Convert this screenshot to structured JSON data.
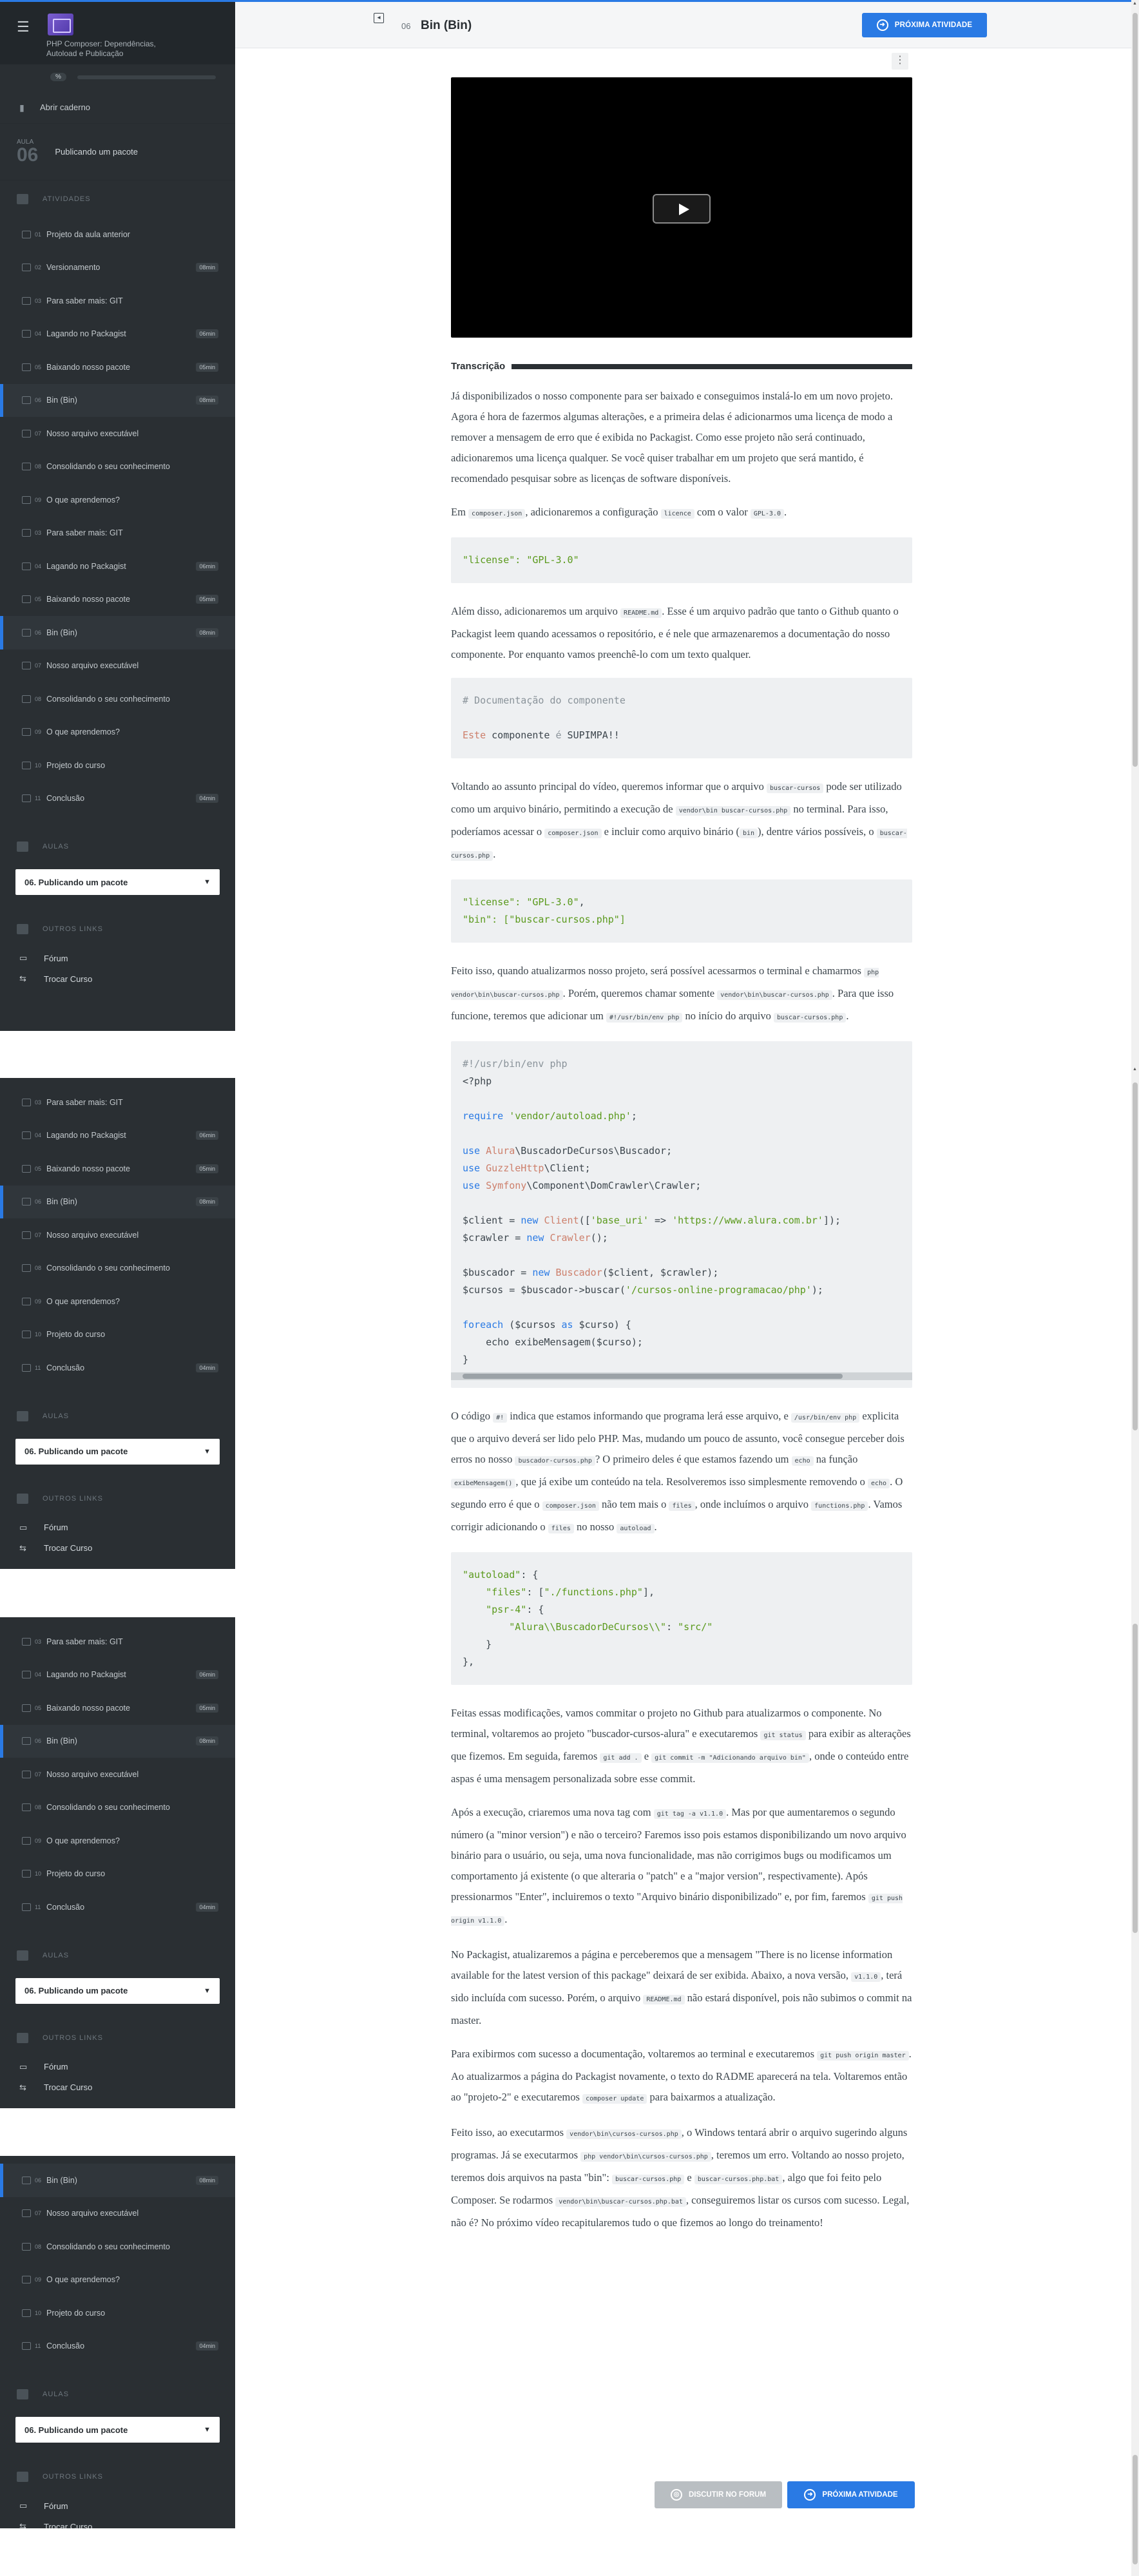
{
  "header": {
    "lesson_number": "06",
    "lesson_title": "Bin (Bin)",
    "next_button": "PRÓXIMA ATIVIDADE"
  },
  "sidebar": {
    "course_title": "PHP Composer: Dependências, Autoload e Publicação",
    "progress_label": "%",
    "progress_fraction": 0.0,
    "open_notebook": "Abrir caderno",
    "section_label": "AULA",
    "section_number": "06",
    "section_title": "Publicando um pacote",
    "activities_label": "ATIVIDADES",
    "classes_label": "AULAS",
    "classes_selected": "06. Publicando um pacote",
    "other_links_label": "OUTROS LINKS",
    "links": [
      "Fórum",
      "Trocar Curso"
    ],
    "activities_first": [
      {
        "num": "01",
        "title": "Projeto da aula anterior",
        "dur": ""
      },
      {
        "num": "02",
        "title": "Versionamento",
        "dur": "08min"
      },
      {
        "num": "03",
        "title": "Para saber mais: GIT",
        "dur": ""
      },
      {
        "num": "04",
        "title": "Lagando no Packagist",
        "dur": "06min"
      },
      {
        "num": "05",
        "title": "Baixando nosso pacote",
        "dur": "05min"
      },
      {
        "num": "06",
        "title": "Bin (Bin)",
        "dur": "08min",
        "active": true
      },
      {
        "num": "07",
        "title": "Nosso arquivo executável",
        "dur": ""
      },
      {
        "num": "08",
        "title": "Consolidando o seu conhecimento",
        "dur": ""
      },
      {
        "num": "09",
        "title": "O que aprendemos?",
        "dur": ""
      },
      {
        "num": "03",
        "title": "Para saber mais: GIT",
        "dur": ""
      },
      {
        "num": "04",
        "title": "Lagando no Packagist",
        "dur": "06min"
      },
      {
        "num": "05",
        "title": "Baixando nosso pacote",
        "dur": "05min"
      },
      {
        "num": "06",
        "title": "Bin (Bin)",
        "dur": "08min",
        "active": true
      },
      {
        "num": "07",
        "title": "Nosso arquivo executável",
        "dur": ""
      },
      {
        "num": "08",
        "title": "Consolidando o seu conhecimento",
        "dur": ""
      },
      {
        "num": "09",
        "title": "O que aprendemos?",
        "dur": ""
      },
      {
        "num": "10",
        "title": "Projeto do curso",
        "dur": ""
      },
      {
        "num": "11",
        "title": "Conclusão",
        "dur": "04min"
      }
    ],
    "activities_repeat": [
      {
        "num": "03",
        "title": "Para saber mais: GIT",
        "dur": ""
      },
      {
        "num": "04",
        "title": "Lagando no Packagist",
        "dur": "06min"
      },
      {
        "num": "05",
        "title": "Baixando nosso pacote",
        "dur": "05min"
      },
      {
        "num": "06",
        "title": "Bin (Bin)",
        "dur": "08min",
        "active": true
      },
      {
        "num": "07",
        "title": "Nosso arquivo executável",
        "dur": ""
      },
      {
        "num": "08",
        "title": "Consolidando o seu conhecimento",
        "dur": ""
      },
      {
        "num": "09",
        "title": "O que aprendemos?",
        "dur": ""
      },
      {
        "num": "10",
        "title": "Projeto do curso",
        "dur": ""
      },
      {
        "num": "11",
        "title": "Conclusão",
        "dur": "04min"
      }
    ],
    "activities_last": [
      {
        "num": "06",
        "title": "Bin (Bin)",
        "dur": "08min",
        "active": true
      },
      {
        "num": "07",
        "title": "Nosso arquivo executável",
        "dur": ""
      },
      {
        "num": "08",
        "title": "Consolidando o seu conhecimento",
        "dur": ""
      },
      {
        "num": "09",
        "title": "O que aprendemos?",
        "dur": ""
      },
      {
        "num": "10",
        "title": "Projeto do curso",
        "dur": ""
      },
      {
        "num": "11",
        "title": "Conclusão",
        "dur": "04min"
      }
    ]
  },
  "main": {
    "transcription_title": "Transcrição",
    "discuss_button": "DISCUTIR NO FORUM",
    "next_button": "PRÓXIMA ATIVIDADE",
    "paragraphs": [
      [
        "Já disponibilizados o nosso componente para ser baixado e conseguimos instalá-lo em um novo projeto. Agora é hora de fazermos algumas alterações, e a primeira delas é adicionarmos uma licença de modo a remover a mensagem de erro que é exibida no Packagist. Como esse projeto não será continuado, adicionaremos uma licença qualquer. Se você quiser trabalhar em um projeto que será mantido, é recomendado pesquisar sobre as licenças de software disponíveis."
      ],
      [
        "Em ",
        {
          "c": "composer.json"
        },
        ", adicionaremos a configuração ",
        {
          "c": "licence"
        },
        " com o valor ",
        {
          "c": "GPL-3.0"
        },
        "."
      ],
      [
        "Além disso, adicionaremos um arquivo ",
        {
          "c": "README.md"
        },
        ". Esse é um arquivo padrão que tanto o Github quanto o Packagist leem quando acessamos o repositório, e é nele que armazenaremos a documentação do nosso componente. Por enquanto vamos preenchê-lo com um texto qualquer."
      ],
      [
        "Voltando ao assunto principal do vídeo, queremos informar que o arquivo ",
        {
          "c": "buscar-cursos"
        },
        " pode ser utilizado como um arquivo binário, permitindo a execução de ",
        {
          "c": "vendor\\bin buscar-cursos.php"
        },
        " no terminal. Para isso, poderíamos acessar o ",
        {
          "c": "composer.json"
        },
        " e incluir como arquivo binário (",
        {
          "c": "bin"
        },
        "), dentre vários possíveis, o ",
        {
          "c": "buscar-cursos.php"
        },
        "."
      ],
      [
        "Feito isso, quando atualizarmos nosso projeto, será possível acessarmos o terminal e chamarmos ",
        {
          "c": "php vendor\\bin\\buscar-cursos.php"
        },
        ". Porém, queremos chamar somente ",
        {
          "c": "vendor\\bin\\buscar-cursos.php"
        },
        ". Para que isso funcione, teremos que adicionar um ",
        {
          "c": "#!/usr/bin/env php"
        },
        " no início do arquivo ",
        {
          "c": "buscar-cursos.php"
        },
        "."
      ],
      [
        "O código ",
        {
          "c": "#!"
        },
        " indica que estamos informando que programa lerá esse arquivo, e ",
        {
          "c": "/usr/bin/env php"
        },
        " explicita que o arquivo deverá ser lido pelo PHP. Mas, mudando um pouco de assunto, você consegue perceber dois erros no nosso ",
        {
          "c": "buscador-cursos.php"
        },
        "? O primeiro deles é que estamos fazendo um ",
        {
          "c": "echo"
        },
        " na função ",
        {
          "c": "exibeMensagem()"
        },
        ", que já exibe um conteúdo na tela. Resolveremos isso simplesmente removendo o ",
        {
          "c": "echo"
        },
        ". O segundo erro é que o ",
        {
          "c": "composer.json"
        },
        " não tem mais o ",
        {
          "c": "files"
        },
        ", onde incluímos o arquivo ",
        {
          "c": "functions.php"
        },
        ". Vamos corrigir adicionando o ",
        {
          "c": "files"
        },
        " no nosso ",
        {
          "c": "autoload"
        },
        "."
      ],
      [
        "Feitas essas modificações, vamos commitar o projeto no Github para atualizarmos o componente. No terminal, voltaremos ao projeto \"buscador-cursos-alura\" e executaremos ",
        {
          "c": "git status"
        },
        " para exibir as alterações que fizemos. Em seguida, faremos ",
        {
          "c": "git add ."
        },
        " e ",
        {
          "c": "git commit -m \"Adicionando arquivo bin\""
        },
        ", onde o conteúdo entre aspas é uma mensagem personalizada sobre esse commit."
      ],
      [
        "Após a execução, criaremos uma nova tag com ",
        {
          "c": "git tag -a v1.1.0"
        },
        ". Mas por que aumentaremos o segundo número (a \"minor version\") e não o terceiro? Faremos isso pois estamos disponibilizando um novo arquivo binário para o usuário, ou seja, uma nova funcionalidade, mas não corrigimos bugs ou modificamos um comportamento já existente (o que alteraria o \"patch\" e a \"major version\", respectivamente). Após pressionarmos \"Enter\", incluiremos o texto \"Arquivo binário disponibilizado\" e, por fim, faremos ",
        {
          "c": "git push origin v1.1.0"
        },
        "."
      ],
      [
        "No Packagist, atualizaremos a página e perceberemos que a mensagem \"There is no license information available for the latest version of this package\" deixará de ser exibida. Abaixo, a nova versão, ",
        {
          "c": "v1.1.0"
        },
        ", terá sido incluída com sucesso. Porém, o arquivo ",
        {
          "c": "README.md"
        },
        " não estará disponível, pois não subimos o commit na master."
      ],
      [
        "Para exibirmos com sucesso a documentação, voltaremos ao terminal e executaremos ",
        {
          "c": "git push origin master"
        },
        ". Ao atualizarmos a página do Packagist novamente, o texto do RADME aparecerá na tela. Voltaremos então ao \"projeto-2\" e executaremos ",
        {
          "c": "composer update"
        },
        " para baixarmos a atualização."
      ],
      [
        "Feito isso, ao executarmos ",
        {
          "c": "vendor\\bin\\cursos-cursos.php"
        },
        ", o Windows tentará abrir o arquivo sugerindo alguns programas. Já se executarmos ",
        {
          "c": "php vendor\\bin\\cursos-cursos.php"
        },
        ", teremos um erro. Voltando ao nosso projeto, teremos dois arquivos na pasta \"bin\": ",
        {
          "c": "buscar-cursos.php"
        },
        " e ",
        {
          "c": "buscar-cursos.php.bat"
        },
        ", algo que foi feito pelo Composer. Se rodarmos ",
        {
          "c": "vendor\\bin\\buscar-cursos.php.bat"
        },
        ", conseguiremos listar os cursos com sucesso. Legal, não é? No próximo vídeo recapitularemos tudo o que fizemos ao longo do treinamento!"
      ]
    ],
    "code_blocks": [
      [
        [
          [
            "s",
            "\"license\": \"GPL-3.0\""
          ]
        ]
      ],
      [
        [
          [
            "c",
            "# Documentação do componente"
          ]
        ],
        [],
        [
          [
            "cl",
            "Este"
          ],
          [
            "t",
            " componente "
          ],
          [
            "c",
            "é"
          ],
          [
            "t",
            " SUPIMPA!!"
          ]
        ]
      ],
      [
        [
          [
            "s",
            "\"license\": \"GPL-3.0\""
          ],
          [
            "t",
            ","
          ]
        ],
        [
          [
            "s",
            "\"bin\": [\"buscar-cursos.php\"]"
          ]
        ]
      ],
      [
        [
          [
            "c",
            "#!/usr/bin/env php"
          ]
        ],
        [
          [
            "t",
            "<?php"
          ]
        ],
        [],
        [
          [
            "k",
            "require"
          ],
          [
            "t",
            " "
          ],
          [
            "s",
            "'vendor/autoload.php'"
          ],
          [
            "t",
            ";"
          ]
        ],
        [],
        [
          [
            "k",
            "use"
          ],
          [
            "t",
            " "
          ],
          [
            "cl",
            "Alura"
          ],
          [
            "t",
            "\\BuscadorDeCursos\\Buscador;"
          ]
        ],
        [
          [
            "k",
            "use"
          ],
          [
            "t",
            " "
          ],
          [
            "cl",
            "GuzzleHttp"
          ],
          [
            "t",
            "\\Client;"
          ]
        ],
        [
          [
            "k",
            "use"
          ],
          [
            "t",
            " "
          ],
          [
            "cl",
            "Symfony"
          ],
          [
            "t",
            "\\Component\\DomCrawler\\Crawler;"
          ]
        ],
        [],
        [
          [
            "t",
            "$client = "
          ],
          [
            "k",
            "new"
          ],
          [
            "t",
            " "
          ],
          [
            "cl",
            "Client"
          ],
          [
            "t",
            "(["
          ],
          [
            "s",
            "'base_uri'"
          ],
          [
            "t",
            " => "
          ],
          [
            "s",
            "'https://www.alura.com.br'"
          ],
          [
            "t",
            "]);"
          ]
        ],
        [
          [
            "t",
            "$crawler = "
          ],
          [
            "k",
            "new"
          ],
          [
            "t",
            " "
          ],
          [
            "cl",
            "Crawler"
          ],
          [
            "t",
            "();"
          ]
        ],
        [],
        [
          [
            "t",
            "$buscador = "
          ],
          [
            "k",
            "new"
          ],
          [
            "t",
            " "
          ],
          [
            "cl",
            "Buscador"
          ],
          [
            "t",
            "($client, $crawler);"
          ]
        ],
        [
          [
            "t",
            "$cursos = $buscador->buscar("
          ],
          [
            "s",
            "'/cursos-online-programacao/php'"
          ],
          [
            "t",
            ");"
          ]
        ],
        [],
        [
          [
            "k",
            "foreach"
          ],
          [
            "t",
            " ($cursos "
          ],
          [
            "k",
            "as"
          ],
          [
            "t",
            " $curso) {"
          ]
        ],
        [
          [
            "t",
            "    echo exibeMensagem($curso);"
          ]
        ],
        [
          [
            "t",
            "}"
          ]
        ]
      ],
      [
        [
          [
            "s",
            "\"autoload\""
          ],
          [
            "t",
            ": {"
          ]
        ],
        [
          [
            "t",
            "    "
          ],
          [
            "s",
            "\"files\""
          ],
          [
            "t",
            ": ["
          ],
          [
            "s",
            "\"./functions.php\""
          ],
          [
            "t",
            "],"
          ]
        ],
        [
          [
            "t",
            "    "
          ],
          [
            "s",
            "\"psr-4\""
          ],
          [
            "t",
            ": {"
          ]
        ],
        [
          [
            "t",
            "        "
          ],
          [
            "s",
            "\"Alura\\\\BuscadorDeCursos\\\\\""
          ],
          [
            "t",
            ": "
          ],
          [
            "s",
            "\"src/\""
          ]
        ],
        [
          [
            "t",
            "    }"
          ]
        ],
        [
          [
            "t",
            "},"
          ]
        ]
      ]
    ]
  },
  "colors": {
    "accent": "#2a7ae4",
    "sidebar_bg": "#2a2f33",
    "string": "#5b9a1d"
  },
  "icons": [
    "menu-icon",
    "course-logo-icon",
    "notebook-icon",
    "activities-icon",
    "classes-icon",
    "other-links-icon",
    "forum-icon",
    "switch-course-icon",
    "collapse-icon",
    "arrow-right-circle-icon",
    "forum-circle-icon",
    "play-icon",
    "more-options-icon"
  ]
}
